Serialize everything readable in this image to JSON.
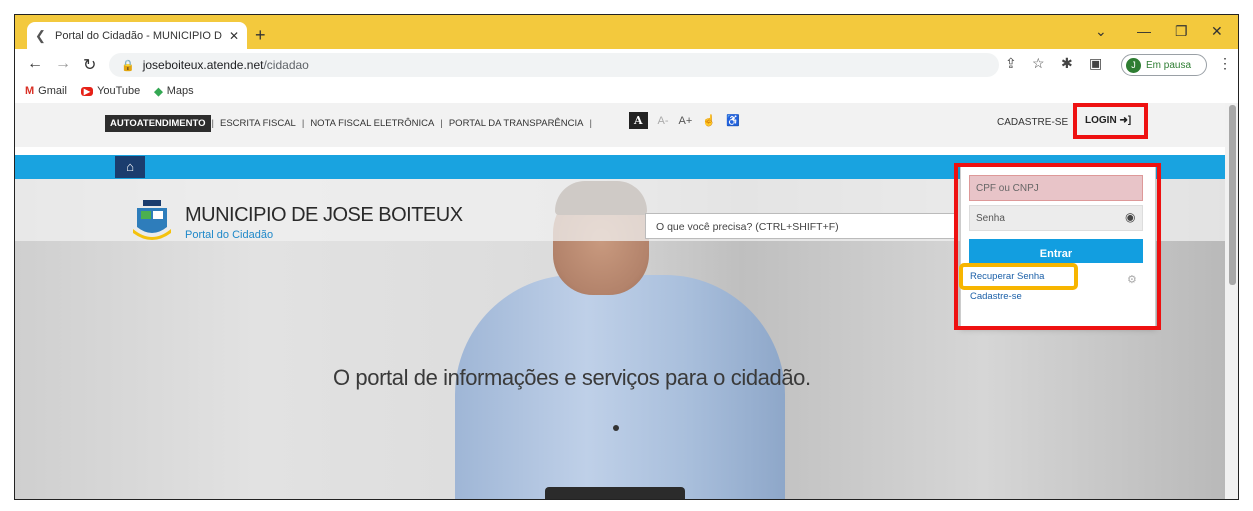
{
  "browser": {
    "tab_title": "Portal do Cidadão - MUNICIPIO D",
    "url_host": "joseboiteux.atende.net",
    "url_path": "/cidadao",
    "profile_initial": "J",
    "profile_status": "Em pausa",
    "bookmarks": [
      {
        "label": "Gmail",
        "icon": "gmail-icon"
      },
      {
        "label": "YouTube",
        "icon": "youtube-icon"
      },
      {
        "label": "Maps",
        "icon": "maps-icon"
      }
    ]
  },
  "site": {
    "nav": [
      "AUTOATENDIMENTO",
      "ESCRITA FISCAL",
      "NOTA FISCAL ELETRÔNICA",
      "PORTAL DA TRANSPARÊNCIA"
    ],
    "a11y": {
      "a": "A",
      "a_minus": "A-",
      "a_plus": "A+"
    },
    "signup": "CADASTRE-SE",
    "login": "LOGIN",
    "municipality": "MUNICIPIO DE JOSE BOITEUX",
    "portal": "Portal do Cidadão",
    "search_placeholder": "O que você precisa? (CTRL+SHIFT+F)",
    "hero_text": "O portal de informações e serviços para o cidadão."
  },
  "login_panel": {
    "cpf_placeholder": "CPF ou CNPJ",
    "password_placeholder": "Senha",
    "submit": "Entrar",
    "recover": "Recuperar Senha",
    "register": "Cadastre-se"
  },
  "colors": {
    "tabstrip": "#f3c93d",
    "bluebar": "#19a3e0",
    "highlight_red": "#ee1111",
    "highlight_orange": "#f7b500"
  }
}
